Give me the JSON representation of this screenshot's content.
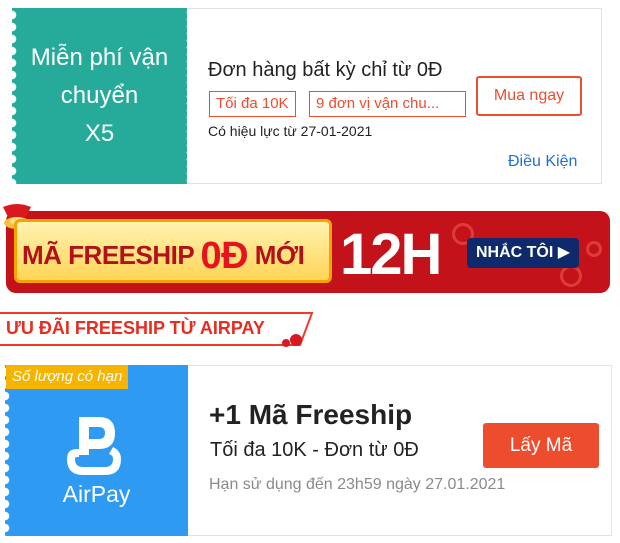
{
  "voucher_freeship": {
    "left_lines": [
      "Miễn phí vận",
      "chuyển",
      "X5"
    ],
    "title": "Đơn hàng bất kỳ chỉ từ 0Đ",
    "tags": [
      "Tối đa 10K",
      "9 đơn vị vận chu..."
    ],
    "buy_label": "Mua ngay",
    "validity": "Có hiệu lực từ 27-01-2021",
    "conditions_link": "Điều Kiện",
    "accent_color": "#26aa99"
  },
  "banner": {
    "text_pre": "MÃ FREESHIP ",
    "text_big": "0Đ",
    "text_post": " MỚI",
    "time": "12H",
    "remind_label": "NHẮC TÔI",
    "colors": {
      "background": "#c4121a",
      "pill": "#ffd457",
      "button": "#0f2a6b"
    }
  },
  "section": {
    "title": "ƯU ĐÃI FREESHIP TỪ AIRPAY"
  },
  "voucher_airpay": {
    "badge": "Số lượng có hạn",
    "brand": "AirPay",
    "title": "+1 Mã Freeship",
    "subtitle": "Tối đa 10K - Đơn từ 0Đ",
    "expiry": "Hạn sử dụng đến 23h59 ngày 27.01.2021",
    "cta_label": "Lấy Mã",
    "accent_color": "#2e9af2",
    "cta_color": "#ee4d2d"
  }
}
